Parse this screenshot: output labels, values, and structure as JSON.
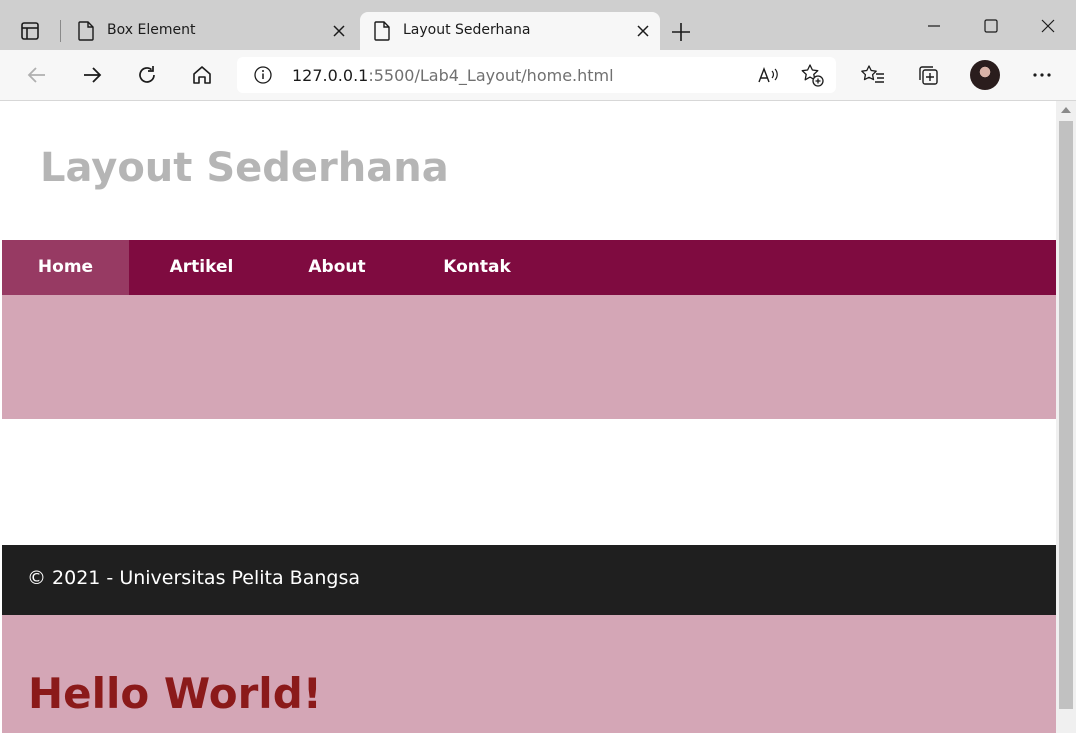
{
  "browser": {
    "tabs": [
      {
        "title": "Box Element",
        "active": false
      },
      {
        "title": "Layout Sederhana",
        "active": true
      }
    ],
    "address": {
      "host": "127.0.0.1",
      "path": ":5500/Lab4_Layout/home.html"
    }
  },
  "page": {
    "site_title": "Layout Sederhana",
    "nav": [
      {
        "label": "Home",
        "active": true
      },
      {
        "label": "Artikel",
        "active": false
      },
      {
        "label": "About",
        "active": false
      },
      {
        "label": "Kontak",
        "active": false
      }
    ],
    "footer_text": "© 2021 - Universitas Pelita Bangsa",
    "heading": "Hello World!"
  },
  "colors": {
    "nav_bg": "#7f0b40",
    "nav_active_bg": "#973a63",
    "hero_bg": "#d4a6b6",
    "footer_bg": "#1f1f1f",
    "heading_color": "#8b1a1a",
    "title_color": "#b5b5b5"
  }
}
